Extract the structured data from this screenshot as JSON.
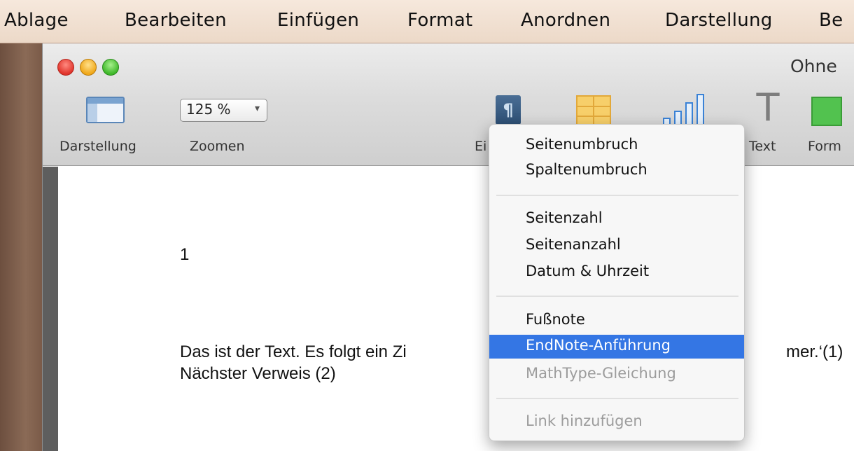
{
  "menubar": {
    "items": [
      "Ablage",
      "Bearbeiten",
      "Einfügen",
      "Format",
      "Anordnen",
      "Darstellung",
      "Be"
    ]
  },
  "window": {
    "title": "Ohne"
  },
  "toolbar": {
    "view_label": "Darstellung",
    "zoom_value": "125 %",
    "zoom_label": "Zoomen",
    "insert_label": "Ei",
    "text_label": "Text",
    "shape_label": "Form"
  },
  "document": {
    "line1": "1",
    "line2_left": "Das ist der Text. Es folgt ein Zi",
    "line2_right": "mer.‘(1)",
    "line3": "Nächster Verweis (2)"
  },
  "insert_menu": {
    "groups": [
      [
        "Seitenumbruch",
        "Spaltenumbruch"
      ],
      [
        "Seitenzahl",
        "Seitenanzahl",
        "Datum & Uhrzeit"
      ],
      [
        "Fußnote",
        "EndNote-Anführung",
        "MathType-Gleichung"
      ],
      [
        "Link hinzufügen"
      ]
    ],
    "highlighted": "EndNote-Anführung",
    "disabled": [
      "MathType-Gleichung",
      "Link hinzufügen"
    ]
  },
  "colors": {
    "highlight": "#3476e4",
    "disabled_text": "#9c9c9c"
  },
  "icons": {
    "view": "sidebar-view-icon",
    "insert": "pilcrow-icon",
    "table": "table-icon",
    "chart": "bar-chart-icon",
    "text": "text-t-icon",
    "shape": "shape-square-icon"
  }
}
